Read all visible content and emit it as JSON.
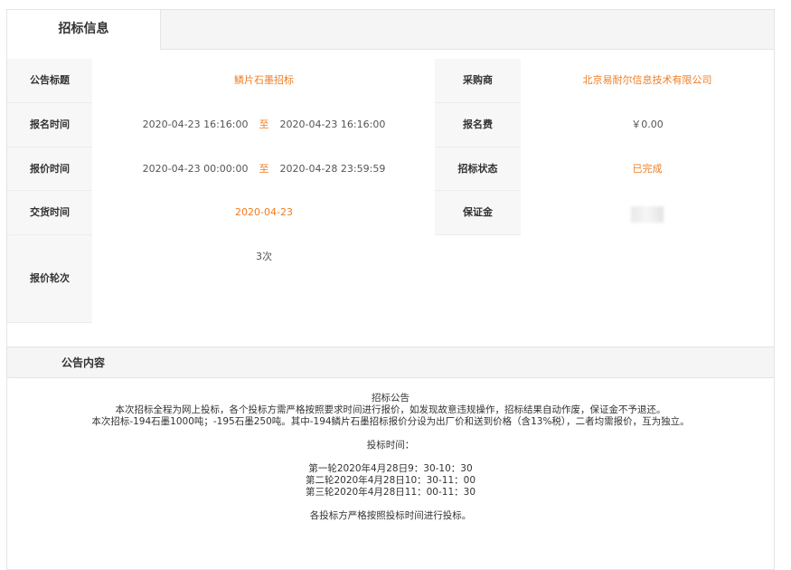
{
  "tab": {
    "label": "招标信息"
  },
  "fields": {
    "title_label": "公告标题",
    "title_value": "鳞片石墨招标",
    "buyer_label": "采购商",
    "buyer_value": "北京易耐尔信息技术有限公司",
    "signup_label": "报名时间",
    "signup_start": "2020-04-23 16:16:00",
    "signup_sep": "至",
    "signup_end": "2020-04-23 16:16:00",
    "fee_label": "报名费",
    "fee_value": "￥0.00",
    "quote_label": "报价时间",
    "quote_start": "2020-04-23 00:00:00",
    "quote_sep": "至",
    "quote_end": "2020-04-28 23:59:59",
    "status_label": "招标状态",
    "status_value": "已完成",
    "delivery_label": "交货时间",
    "delivery_value": "2020-04-23",
    "deposit_label": "保证金",
    "rounds_label": "报价轮次",
    "rounds_value": "3次"
  },
  "section": {
    "title": "公告内容"
  },
  "notice": {
    "heading": "招标公告",
    "p1": "本次招标全程为网上投标，各个投标方需严格按照要求时间进行报价，如发现故意违规操作，招标结果自动作废，保证金不予退还。",
    "p2": "本次招标-194石墨1000吨；-195石墨250吨。其中-194鳞片石墨招标报价分设为出厂价和送到价格（含13%税），二者均需报价，互为独立。",
    "time_title": "投标时间：",
    "round1": "第一轮2020年4月28日9：30-10：30",
    "round2": "第二轮2020年4月28日10：30-11：00",
    "round3": "第三轮2020年4月28日11：00-11：30",
    "closing": "各投标方严格按照投标时间进行投标。"
  },
  "colors": {
    "accent": "#f07c22",
    "label_bg": "#f7f7f7",
    "bar_bg": "#f5f5f5"
  }
}
